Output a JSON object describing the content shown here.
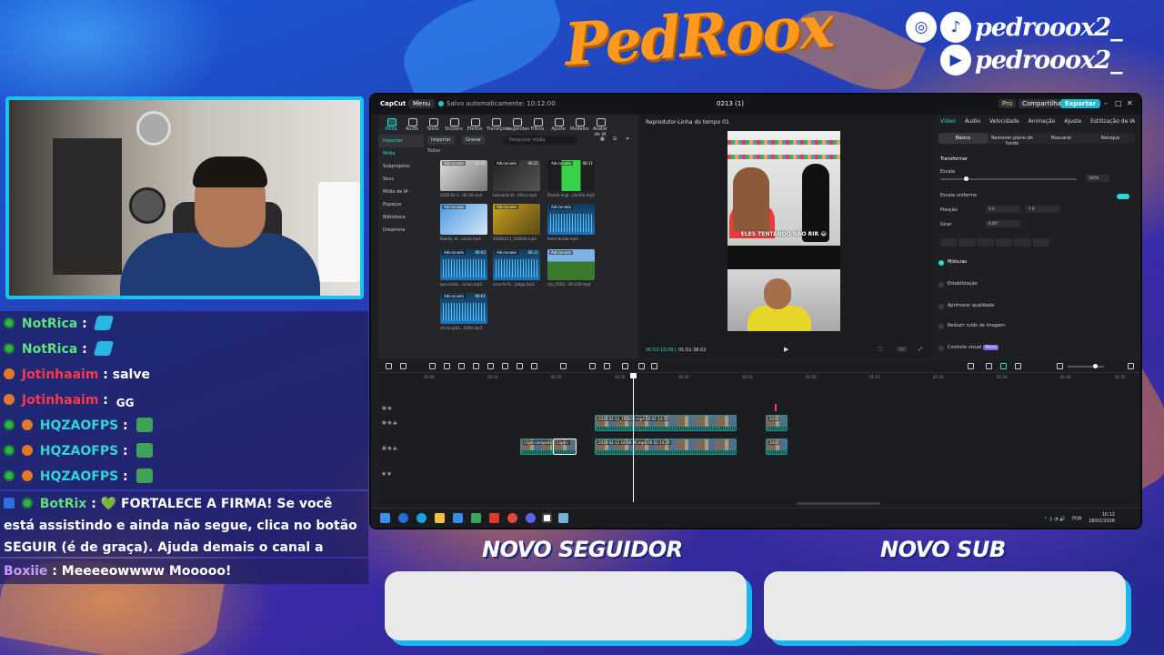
{
  "brand": {
    "name": "PedRoox"
  },
  "socials": [
    {
      "icons": [
        "instagram-icon",
        "tiktok-icon"
      ],
      "handle": "pedrooox2_"
    },
    {
      "icons": [
        "youtube-icon"
      ],
      "handle": "pedrooox2_"
    }
  ],
  "chat": [
    {
      "badges": [
        "verified"
      ],
      "user": "NotRica",
      "sep": ":",
      "text": "",
      "emote": "hype-emote",
      "user_color": "#5fe27a"
    },
    {
      "badges": [
        "verified"
      ],
      "user": "NotRica",
      "sep": ":",
      "text": "",
      "emote": "hype-emote",
      "user_color": "#5fe27a"
    },
    {
      "badges": [
        "vip"
      ],
      "user": "Jotinhaaim",
      "sep": ":",
      "text": "salve",
      "emote": "",
      "user_color": "#ff3848"
    },
    {
      "badges": [
        "vip"
      ],
      "user": "Jotinhaaim",
      "sep": ":",
      "text": "",
      "emote": "GG",
      "user_color": "#ff3848"
    },
    {
      "badges": [
        "verified",
        "vip"
      ],
      "user": "HQZAOFPS",
      "sep": ":",
      "text": "",
      "emote": "frog-emote",
      "user_color": "#31d6d6"
    },
    {
      "badges": [
        "verified",
        "vip"
      ],
      "user": "HQZAOFPS",
      "sep": ":",
      "text": "",
      "emote": "frog-emote",
      "user_color": "#31d6d6"
    },
    {
      "badges": [
        "verified",
        "vip"
      ],
      "user": "HQZAOFPS",
      "sep": ":",
      "text": "",
      "emote": "frog-emote",
      "user_color": "#31d6d6"
    },
    {
      "badges": [
        "broadcaster",
        "verified"
      ],
      "user": "BotRix",
      "sep": ":",
      "text": "💚 FORTALECE A FIRMA! Se você está assistindo e ainda não segue, clica no botão SEGUIR (é de graça). Ajuda demais o canal a crescer! 📈",
      "emote": "",
      "user_color": "#5fe27a"
    },
    {
      "badges": [],
      "user": "Boxiie",
      "sep": ":",
      "text": "Meeeeowwww Mooooo!",
      "emote": "",
      "user_color": "#c49bff"
    }
  ],
  "editor": {
    "titlebar": {
      "app": "CapCut",
      "menu": "Menu",
      "saved": "Salvo automaticamente: 10:12:00",
      "project": "0213 (1)",
      "pro": "Pro",
      "share": "Compartilhar",
      "export": "Exportar"
    },
    "media_tabs": [
      "Mídia",
      "Áudio",
      "Texto",
      "Stickers",
      "Efeitos",
      "Transições",
      "Legendas",
      "Filtros",
      "Ajuste",
      "Modelos",
      "Avatar de IA"
    ],
    "media_side": [
      "Importar",
      "Mídia",
      "Subprojetos",
      "Seus",
      "Mídia de IA",
      "Espaços",
      "Biblioteca",
      "Dreamina"
    ],
    "media_bar": {
      "import": "Importar",
      "record": "Gravar",
      "search_placeholder": "Pesquisar mídia"
    },
    "media_all": "Todos",
    "media_items": [
      {
        "tag": "Adicionado",
        "dur": "12:25",
        "name": "2026-02-1...06-36.mp4",
        "kind": "video"
      },
      {
        "tag": "Adicionado",
        "dur": "00:21",
        "name": "Leonardo D...rifical.mp4",
        "kind": "video"
      },
      {
        "tag": "Adicionado",
        "dur": "00:11",
        "name": "Risada engl...ahorita.mp4",
        "kind": "video"
      },
      {
        "tag": "Adicionado",
        "dur": "",
        "name": "Reality sh...carna.mp4",
        "kind": "video"
      },
      {
        "tag": "Adicionado",
        "dur": "",
        "name": "20260213_160024.mp4",
        "kind": "video"
      },
      {
        "tag": "Adicionado",
        "dur": "",
        "name": "hmm-bruda.mp3",
        "kind": "audio"
      },
      {
        "tag": "Adicionado",
        "dur": "00:03",
        "name": "que-onda-...aman.mp3",
        "kind": "audio"
      },
      {
        "tag": "Adicionado",
        "dur": "00:11",
        "name": "voce-te-fu...jadga.mp3",
        "kind": "audio"
      },
      {
        "tag": "Adicionado",
        "dur": "",
        "name": "clip_0162...09-239.mp4",
        "kind": "video"
      },
      {
        "tag": "Adicionado",
        "dur": "00:01",
        "name": "oh-no-gato...2020.mp3",
        "kind": "audio"
      }
    ],
    "player": {
      "header": "Reprodutor-Linha do tempo 01",
      "caption": "ELES TENTANDO NÃO RIR 😂",
      "current": "00:52:10:08",
      "total": "01:51:38:02"
    },
    "props": {
      "tabs": [
        "Vídeo",
        "Áudio",
        "Velocidade",
        "Animação",
        "Ajuste",
        "Estilização de IA"
      ],
      "subtabs": [
        "Básico",
        "Remover plano de fundo",
        "Mascarar",
        "Retoque"
      ],
      "transform": "Transformar",
      "scale_label": "Escala",
      "scale_value": "100%",
      "uniform_scale": "Escala uniforme",
      "position_label": "Posição",
      "pos_x_label": "X",
      "pos_x": "0",
      "pos_y_label": "Y",
      "pos_y": "0",
      "rotate_label": "Girar",
      "rotate_value": "0.00°",
      "blend": "Misturas",
      "stabilize": "Estabilização",
      "enhance": "Aprimorar qualidade",
      "denoise": "Reduzir ruído de imagem",
      "visual_control": "Controle visual",
      "badge": "Novo"
    },
    "timeline": {
      "ruler": [
        "00:00",
        "00:10",
        "00:20",
        "00:30",
        "00:40",
        "00:50",
        "01:00",
        "01:10",
        "01:20",
        "01:30",
        "01:40",
        "01:50"
      ],
      "clips": [
        {
          "label": "2026-02-12_160024.mp4  00:02:14:29"
        },
        {
          "label": "Clipe composto"
        },
        {
          "label": "Clipe c"
        },
        {
          "label": "2026-02-12 16-06-36.mp4  00:02:14:29"
        },
        {
          "label": "2026"
        },
        {
          "label": "2026"
        }
      ]
    },
    "taskbar": {
      "lang": "POR",
      "time": "10:12",
      "date": "28/02/2026"
    }
  },
  "alerts": {
    "follower": "NOVO SEGUIDOR",
    "sub": "NOVO SUB"
  }
}
